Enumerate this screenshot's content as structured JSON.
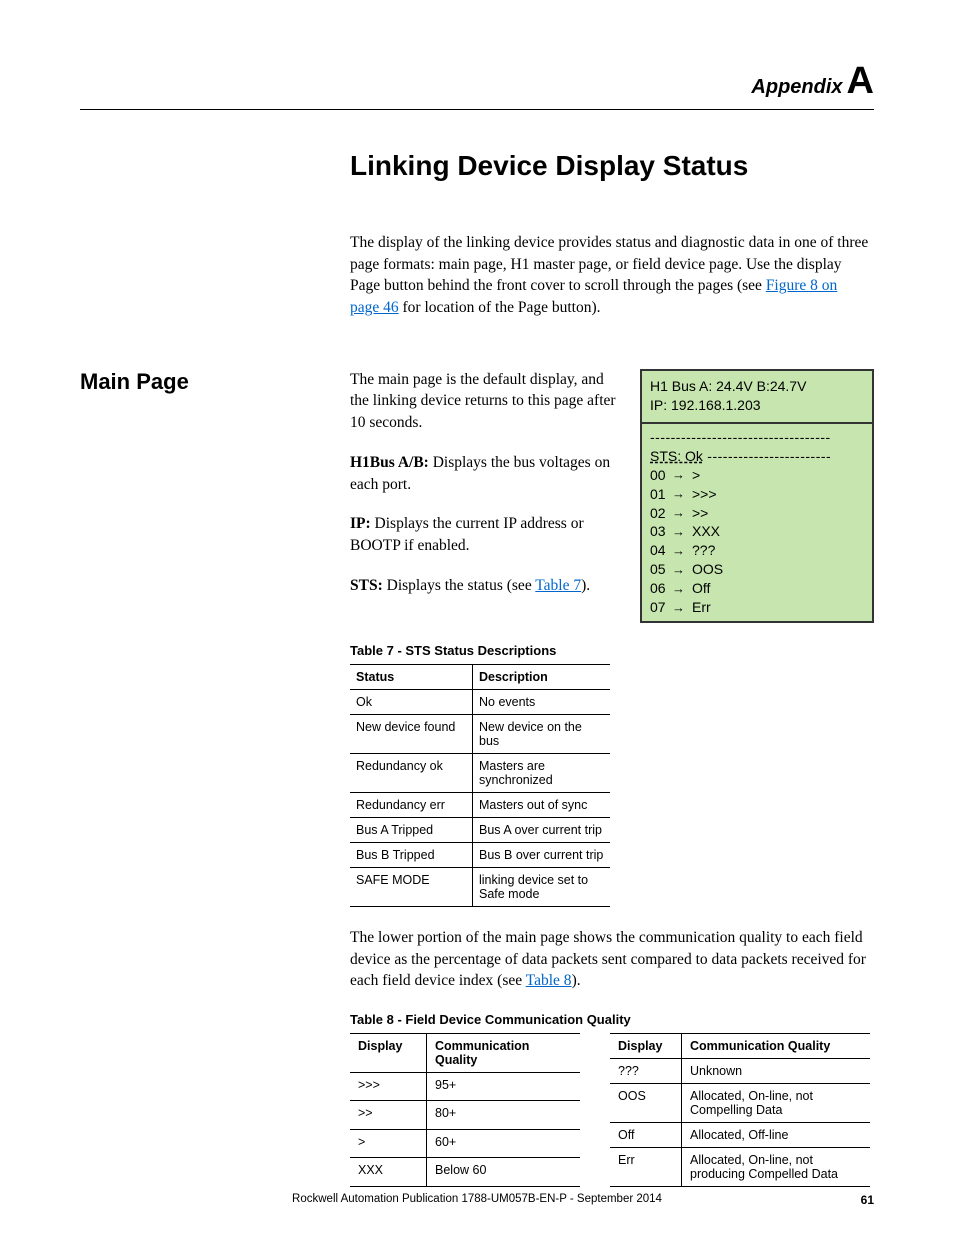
{
  "header": {
    "appendix_word": "Appendix",
    "appendix_letter": "A"
  },
  "title": "Linking Device Display Status",
  "intro": {
    "text_before_link": "The display of the linking device provides status and diagnostic data in one of three page formats: main page, H1 master page, or field device page. Use the display Page button behind the front cover to scroll through the pages (see ",
    "link_text": "Figure 8 on page 46",
    "text_after_link": " for location of the Page button)."
  },
  "side_heading": "Main Page",
  "main_text": {
    "p1": "The main page is the default display, and the linking device returns to this page after 10 seconds.",
    "p2_label": "H1Bus A/B:",
    "p2_rest": " Displays the bus voltages on each port.",
    "p3_label": "IP:",
    "p3_rest": " Displays the current IP address or BOOTP if enabled.",
    "p4_label": "STS:",
    "p4_rest_before": " Displays the status (see ",
    "p4_link": "Table 7",
    "p4_rest_after": ")."
  },
  "panel": {
    "line1": "H1 Bus  A: 24.4V   B:24.7V",
    "line2": "IP: 192.168.1.203",
    "dash_top": "-----------------------------------",
    "sts_line_prefix": "STS: Ok",
    "dash_mid": " ------------------------",
    "rows": [
      {
        "idx": "00",
        "val": ">"
      },
      {
        "idx": "01",
        "val": ">>>"
      },
      {
        "idx": "02",
        "val": ">>"
      },
      {
        "idx": "03",
        "val": "XXX"
      },
      {
        "idx": "04",
        "val": "???"
      },
      {
        "idx": "05",
        "val": "OOS"
      },
      {
        "idx": "06",
        "val": "Off"
      },
      {
        "idx": "07",
        "val": "Err"
      }
    ]
  },
  "table7": {
    "caption": "Table 7 - STS Status Descriptions",
    "head": {
      "c1": "Status",
      "c2": "Description"
    },
    "rows": [
      {
        "c1": "Ok",
        "c2": "No events"
      },
      {
        "c1": "New device found",
        "c2": "New device on the bus"
      },
      {
        "c1": "Redundancy ok",
        "c2": "Masters are synchronized"
      },
      {
        "c1": "Redundancy err",
        "c2": "Masters out of sync"
      },
      {
        "c1": "Bus A Tripped",
        "c2": "Bus A over current trip"
      },
      {
        "c1": "Bus B Tripped",
        "c2": "Bus B over current trip"
      },
      {
        "c1": "SAFE MODE",
        "c2": "linking device set to Safe mode"
      }
    ]
  },
  "para2": {
    "before": "The lower portion of the main page shows the communication quality to each field device as the percentage of data packets sent compared to data packets received for each field device index (see ",
    "link": "Table 8",
    "after": ")."
  },
  "table8": {
    "caption": "Table 8 - Field Device Communication Quality",
    "head": {
      "c1": "Display",
      "c2": "Communication Quality"
    },
    "left_rows": [
      {
        "c1": ">>>",
        "c2": "95+"
      },
      {
        "c1": ">>",
        "c2": "80+"
      },
      {
        "c1": ">",
        "c2": "60+"
      },
      {
        "c1": "XXX",
        "c2": "Below 60"
      }
    ],
    "right_rows": [
      {
        "c1": "???",
        "c2": "Unknown"
      },
      {
        "c1": "OOS",
        "c2": "Allocated, On-line, not Compelling Data"
      },
      {
        "c1": "Off",
        "c2": "Allocated, Off-line"
      },
      {
        "c1": "Err",
        "c2": "Allocated, On-line, not producing Compelled Data"
      }
    ]
  },
  "footer": {
    "pub": "Rockwell Automation Publication 1788-UM057B-EN-P - September 2014",
    "page": "61"
  }
}
